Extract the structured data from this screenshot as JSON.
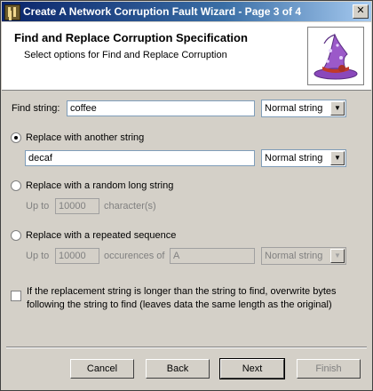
{
  "window": {
    "title": "Create A Network Corruption Fault Wizard - Page 3 of 4",
    "close_glyph": "✕"
  },
  "header": {
    "title": "Find and Replace Corruption Specification",
    "subtitle": "Select options for Find and Replace Corruption"
  },
  "find": {
    "label": "Find string:",
    "value": "coffee",
    "type": "Normal string"
  },
  "replace_another": {
    "label": "Replace with another string",
    "selected": true,
    "value": "decaf",
    "type": "Normal string"
  },
  "replace_random": {
    "label": "Replace with a random long string",
    "selected": false,
    "upto_label": "Up to",
    "length": "10000",
    "unit": "character(s)"
  },
  "replace_repeated": {
    "label": "Replace with a repeated sequence",
    "selected": false,
    "upto_label": "Up to",
    "count": "10000",
    "of_label": "occurences of",
    "sequence": "A",
    "type": "Normal string"
  },
  "overwrite": {
    "checked": false,
    "line1": "If the replacement string is longer than the string to find, overwrite bytes",
    "line2": "following the string to find (leaves data the same length as the original)"
  },
  "buttons": {
    "cancel": {
      "label": "Cancel",
      "enabled": true
    },
    "back": {
      "label": "Back",
      "enabled": true
    },
    "next": {
      "label": "Next",
      "enabled": true
    },
    "finish": {
      "label": "Finish",
      "enabled": false
    }
  },
  "icons": {
    "app": "app-icon",
    "wizard": "wizard-hat-icon"
  },
  "colors": {
    "titlebar": "#0a246a",
    "face": "#d4d0c8",
    "hat": "#9b59c9"
  }
}
